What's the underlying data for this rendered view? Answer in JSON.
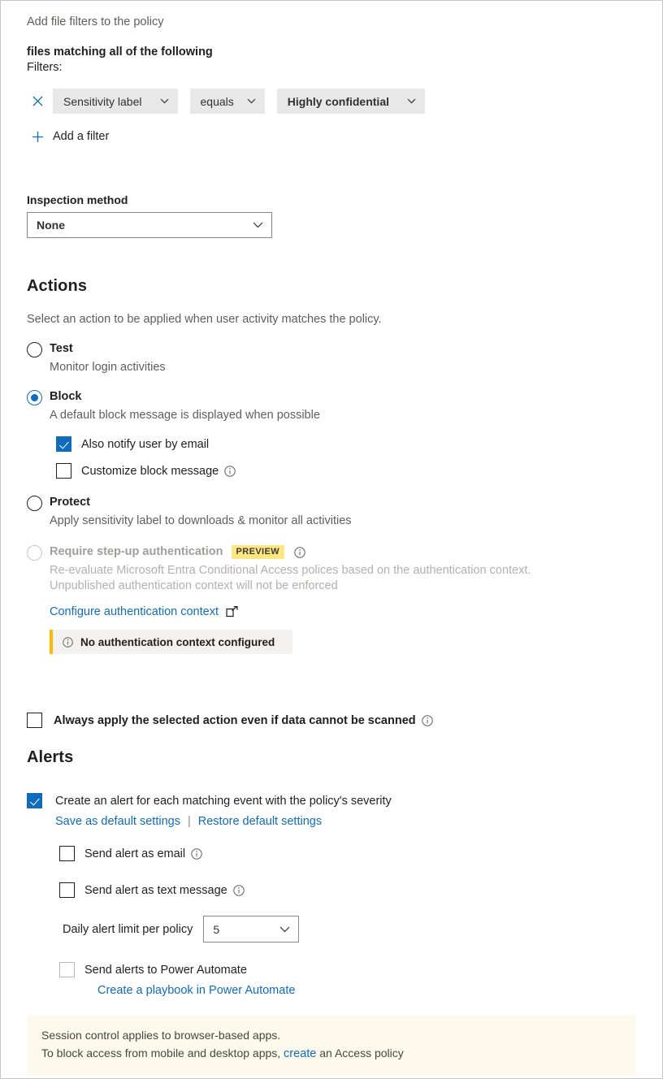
{
  "filters": {
    "intro": "Add file filters to the policy",
    "matching_label": "files matching all of the following",
    "filters_label": "Filters:",
    "row": {
      "field": "Sensitivity label",
      "operator": "equals",
      "value": "Highly confidential"
    },
    "add_filter_label": "Add a filter"
  },
  "inspection": {
    "label": "Inspection method",
    "value": "None"
  },
  "actions": {
    "heading": "Actions",
    "description": "Select an action to be applied when user activity matches the policy.",
    "options": [
      {
        "title": "Test",
        "subtitle": "Monitor login activities",
        "selected": false
      },
      {
        "title": "Block",
        "subtitle": "A default block message is displayed when possible",
        "selected": true
      },
      {
        "title": "Protect",
        "subtitle": "Apply sensitivity label to downloads & monitor all activities",
        "selected": false
      },
      {
        "title": "Require step-up authentication",
        "badge": "PREVIEW",
        "subtitle_line1": "Re-evaluate Microsoft Entra Conditional Access polices based on the authentication context.",
        "subtitle_line2": "Unpublished authentication context will not be enforced",
        "selected": false,
        "disabled": true
      }
    ],
    "block_suboptions": [
      {
        "label": "Also notify user by email",
        "checked": true,
        "info": false
      },
      {
        "label": "Customize block message",
        "checked": false,
        "info": true
      }
    ],
    "configure_auth_link": "Configure authentication context",
    "auth_message": "No authentication context configured",
    "always_apply": {
      "label": "Always apply the selected action even if data cannot be scanned",
      "checked": false,
      "info": true
    }
  },
  "alerts": {
    "heading": "Alerts",
    "create_alert": {
      "label": "Create an alert for each matching event with the policy's severity",
      "checked": true
    },
    "save_default_link": "Save as default settings",
    "separator": "|",
    "restore_default_link": "Restore default settings",
    "options": [
      {
        "label": "Send alert as email",
        "checked": false,
        "info": true
      },
      {
        "label": "Send alert as text message",
        "checked": false,
        "info": true
      }
    ],
    "daily_limit": {
      "label": "Daily alert limit per policy",
      "value": "5"
    },
    "power_automate": {
      "label": "Send alerts to Power Automate",
      "checked": false,
      "link": "Create a playbook in Power Automate"
    }
  },
  "notice": {
    "line1": "Session control applies to browser-based apps.",
    "line2_prefix": "To block access from mobile and desktop apps, ",
    "line2_link": "create",
    "line2_suffix": " an Access policy"
  },
  "icons": {
    "close": "close-icon",
    "plus": "plus-icon",
    "chevron": "chevron-down-icon",
    "info": "info-icon",
    "external": "external-link-icon"
  },
  "colors": {
    "accent": "#0f6cbd",
    "link": "#0f6cbd",
    "warning": "#ffb900",
    "preview_badge": "#ffe680",
    "notice_bg": "#fdf9ec"
  }
}
